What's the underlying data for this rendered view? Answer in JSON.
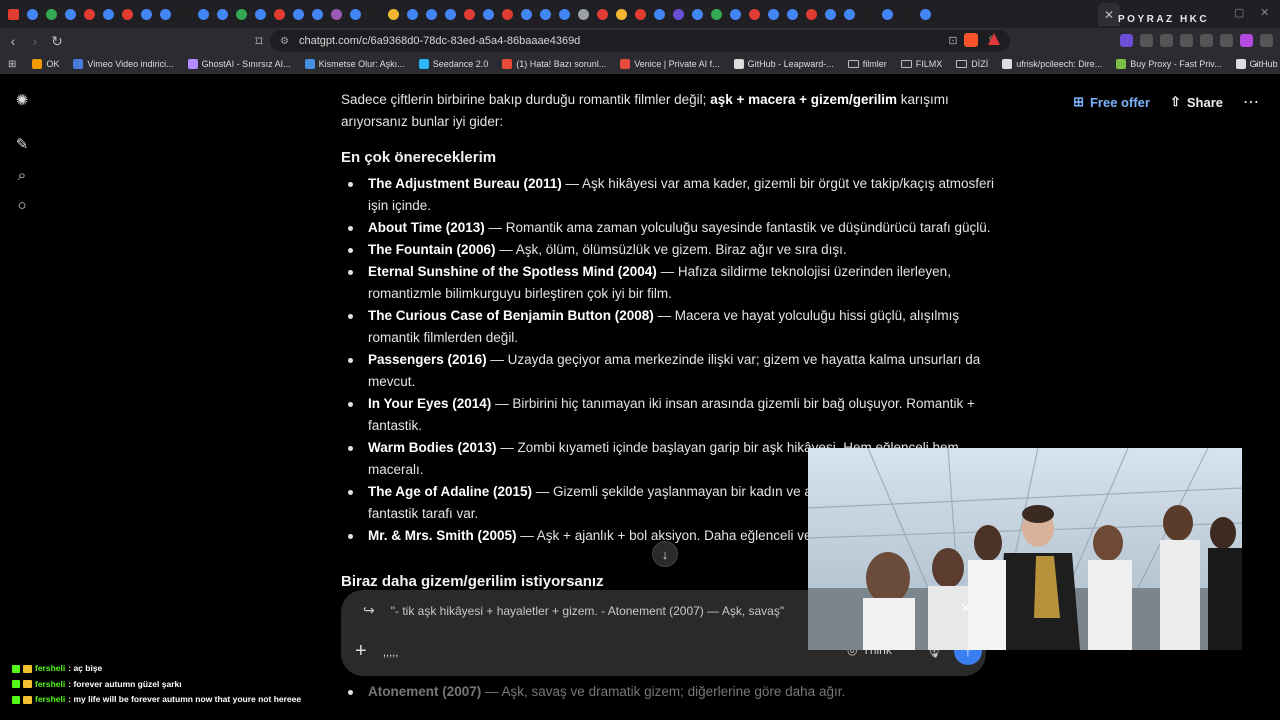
{
  "browser": {
    "brand_overlay": "POYRAZ HKC",
    "url": "chatgpt.com/c/6a9368d0-78dc-83ed-a5a4-86baaae4369d",
    "tab_colors": [
      "#e03c31",
      "#4285f4",
      "#34a853",
      "#4285f4",
      "#e03c31",
      "#4285f4",
      "#e03c31",
      "#4285f4",
      "#4285f4",
      "#202020",
      "#4285f4",
      "#4285f4",
      "#34a853",
      "#4285f4",
      "#e03c31",
      "#4285f4",
      "#4285f4",
      "#9b59b6",
      "#4285f4",
      "#202020",
      "#f2b632",
      "#4285f4",
      "#4285f4",
      "#4285f4",
      "#e03c31",
      "#4285f4",
      "#e03c31",
      "#4285f4",
      "#4285f4",
      "#4285f4",
      "#9aa0a6",
      "#e03c31",
      "#f2b632",
      "#e03c31",
      "#4285f4",
      "#6c4fd6",
      "#4285f4",
      "#34a853",
      "#4285f4",
      "#e03c31",
      "#4285f4",
      "#4285f4",
      "#e03c31",
      "#4285f4",
      "#4285f4",
      "#202020",
      "#4285f4",
      "#202020",
      "#4285f4"
    ]
  },
  "bookmarks": [
    {
      "label": "OK",
      "color": "#f29900"
    },
    {
      "label": "Vimeo Video indirici...",
      "color": "#4a7bd8"
    },
    {
      "label": "GhostAI - Sınırsız AI...",
      "color": "#b58cff"
    },
    {
      "label": "Kismetse Olur: Aşkı...",
      "color": "#4a90e2"
    },
    {
      "label": "Seedance 2.0",
      "color": "#29b6f6"
    },
    {
      "label": "(1) Hata! Bazı sorunl...",
      "color": "#e84a3b"
    },
    {
      "label": "Venice | Private AI f...",
      "color": "#e84a3b"
    },
    {
      "label": "GitHub - Leapward-...",
      "color": "#dddddd"
    },
    {
      "label": "filmler",
      "color": "folder"
    },
    {
      "label": "FILMX",
      "color": "folder"
    },
    {
      "label": "DİZİ",
      "color": "folder"
    },
    {
      "label": "ufrisk/pcileech: Dire...",
      "color": "#dddddd"
    },
    {
      "label": "Buy Proxy - Fast Priv...",
      "color": "#7bc043"
    },
    {
      "label": "GitHub - xmkg/ko-t...",
      "color": "#dddddd"
    }
  ],
  "header": {
    "free_offer": "Free offer",
    "share": "Share"
  },
  "content": {
    "intro_plain": "Sadece çiftlerin birbirine bakıp durduğu romantik filmler değil; ",
    "intro_bold": "aşk + macera + gizem/gerilim",
    "intro_rest": " karışımı arıyorsanız bunlar iyi gider:",
    "heading1": "En çok önereceklerim",
    "items": [
      {
        "title": "The Adjustment Bureau (2011)",
        "desc": " — Aşk hikâyesi var ama kader, gizemli bir örgüt ve takip/kaçış atmosferi işin içinde."
      },
      {
        "title": "About Time (2013)",
        "desc": " — Romantik ama zaman yolculuğu sayesinde fantastik ve düşündürücü tarafı güçlü."
      },
      {
        "title": "The Fountain (2006)",
        "desc": " — Aşk, ölüm, ölümsüzlük ve gizem. Biraz ağır ve sıra dışı."
      },
      {
        "title": "Eternal Sunshine of the Spotless Mind (2004)",
        "desc": " — Hafıza sildirme teknolojisi üzerinden ilerleyen, romantizmle bilimkurguyu birleştiren çok iyi bir film."
      },
      {
        "title": "The Curious Case of Benjamin Button (2008)",
        "desc": " — Macera ve hayat yolculuğu hissi güçlü, alışılmış romantik filmlerden değil."
      },
      {
        "title": "Passengers (2016)",
        "desc": " — Uzayda geçiyor ama merkezinde ilişki var; gizem ve hayatta kalma unsurları da mevcut."
      },
      {
        "title": "In Your Eyes (2014)",
        "desc": " — Birbirini hiç tanımayan iki insan arasında gizemli bir bağ oluşuyor. Romantik + fantastik."
      },
      {
        "title": "Warm Bodies (2013)",
        "desc": " — Zombi kıyameti içinde başlayan garip bir aşk hikâyesi. Hem eğlenceli hem maceralı."
      },
      {
        "title": "The Age of Adaline (2015)",
        "desc": " — Gizemli şekilde yaşlanmayan bir kadın ve aşk hikâyesi; dramatik ama fantastik tarafı var."
      },
      {
        "title": "Mr. & Mrs. Smith (2005)",
        "desc": " — Aşk + ajanlık + bol aksiyon. Daha eğlenceli ve hafif bir seçenek."
      }
    ],
    "heading2": "Biraz daha gizem/gerilim istiyorsanız",
    "faded_item_title": "Atonement (2007)",
    "faded_item_desc": " — Aşk, savaş ve dramatik gizem; diğerlerine göre daha ağır."
  },
  "composer": {
    "quote": "\"- tik aşk hikâyesi + hayaletler + gizem. - Atonement (2007) — Aşk, savaş\"",
    "input_value": ",,,,,",
    "think_label": "Think"
  },
  "chat": [
    {
      "user": "fersheli",
      "message": " : aç bişe"
    },
    {
      "user": "fersheli",
      "message": " : forever autumn güzel şarkı"
    },
    {
      "user": "fersheli",
      "message": " : my life will be forever autumn now that youre not hereee"
    }
  ]
}
